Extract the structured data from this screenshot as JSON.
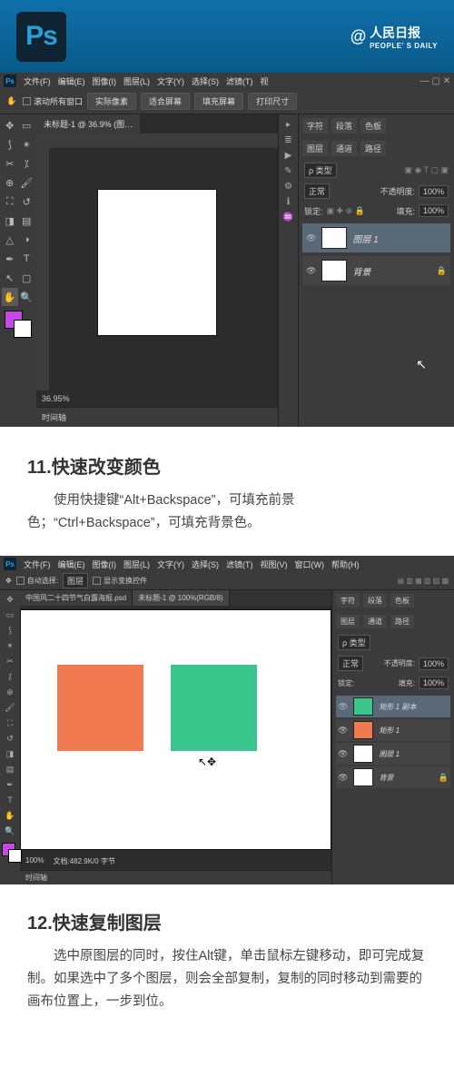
{
  "header": {
    "logo": "Ps",
    "author_at": "@",
    "author_name": "人民日报",
    "author_sub": "PEOPLE' S DAILY"
  },
  "shot1": {
    "menubar": [
      "文件(F)",
      "编辑(E)",
      "图像(I)",
      "图层(L)",
      "文字(Y)",
      "选择(S)",
      "滤镜(T)",
      "视"
    ],
    "optbar": {
      "scroll_check": "滚动所有窗口",
      "actual_px": "实际像素",
      "fit_screen": "适合屏幕",
      "fill_screen": "填充屏幕",
      "print_size": "打印尺寸"
    },
    "doc_tab": "未标题-1 @ 36.9% (图…",
    "zoom_pct": "36.95%",
    "timeline": "时间轴",
    "panels": {
      "tabs_top": [
        "字符",
        "段落",
        "色板"
      ],
      "tabs_layer": [
        "图层",
        "通道",
        "路径"
      ],
      "kind": "ρ 类型",
      "blend_mode": "正常",
      "opacity_label": "不透明度:",
      "opacity": "100%",
      "lock_label": "锁定:",
      "fill_label": "填充:",
      "fill": "100%",
      "layers": [
        {
          "name": "图层 1",
          "active": true
        },
        {
          "name": "背景",
          "locked": true
        }
      ]
    }
  },
  "tip11": {
    "title": "11.快速改变颜色",
    "body": "使用快捷键“Alt+Backspace”，可填充前景色；“Ctrl+Backspace”，可填充背景色。"
  },
  "shot2": {
    "menubar": [
      "文件(F)",
      "编辑(E)",
      "图像(I)",
      "图层(L)",
      "文字(Y)",
      "选择(S)",
      "滤镜(T)",
      "视图(V)",
      "窗口(W)",
      "帮助(H)"
    ],
    "optbar": {
      "auto_sel": "自动选择:",
      "target": "图层",
      "show_transform": "显示变换控件"
    },
    "tabs": [
      "中国风二十四节气白露海报.psd",
      "未标题-1 @ 100%(RGB/8)"
    ],
    "status_zoom": "100%",
    "status_doc": "文档:482.9K/0 字节",
    "timeline": "时间轴",
    "panels": {
      "tabs_top": [
        "字符",
        "段落",
        "色板"
      ],
      "tabs_layer": [
        "图层",
        "通道",
        "路径"
      ],
      "kind": "ρ 类型",
      "blend_mode": "正常",
      "opacity_label": "不透明度:",
      "opacity": "100%",
      "lock_label": "锁定:",
      "fill_label": "填充:",
      "fill": "100%",
      "layers": [
        {
          "name": "矩形 1 副本",
          "thumb": "#3ac58d",
          "active": true
        },
        {
          "name": "矩形 1",
          "thumb": "#f17a50"
        },
        {
          "name": "图层 1",
          "thumb": "#fff"
        },
        {
          "name": "背景",
          "thumb": "#fff",
          "locked": true
        }
      ]
    }
  },
  "tip12": {
    "title": "12.快速复制图层",
    "body": "选中原图层的同时，按住Alt键，单击鼠标左键移动，即可完成复制。如果选中了多个图层，则会全部复制，复制的同时移动到需要的画布位置上，一步到位。"
  }
}
